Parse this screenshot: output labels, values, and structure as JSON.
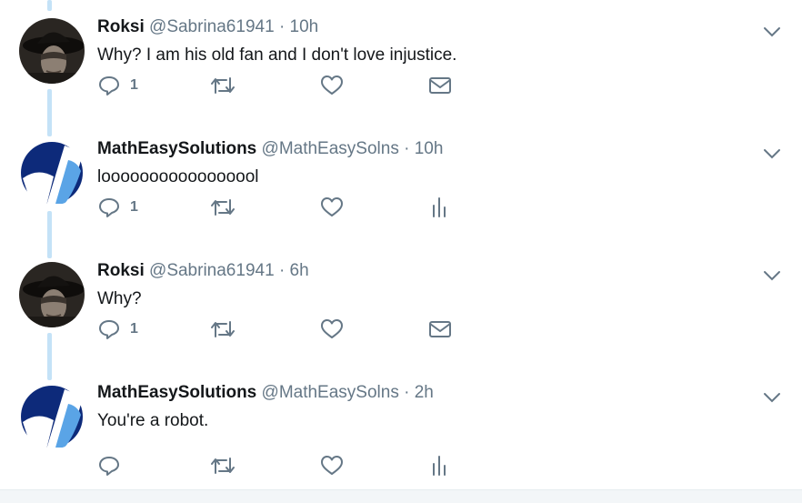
{
  "tweets": [
    {
      "name": "Roksi",
      "handle": "@Sabrina61941",
      "separator": "·",
      "time": "10h",
      "text": "Why? I am his old fan and I don't love injustice.",
      "reply_count": "1",
      "avatar": "hat-woman-photo",
      "last_action_icon": "mail-icon"
    },
    {
      "name": "MathEasySolutions",
      "handle": "@MathEasySolns",
      "separator": "·",
      "time": "10h",
      "text": "looooooooooooooool",
      "reply_count": "1",
      "avatar": "math-logo",
      "last_action_icon": "analytics-icon"
    },
    {
      "name": "Roksi",
      "handle": "@Sabrina61941",
      "separator": "·",
      "time": "6h",
      "text": "Why?",
      "reply_count": "1",
      "avatar": "hat-woman-photo",
      "last_action_icon": "mail-icon"
    },
    {
      "name": "MathEasySolutions",
      "handle": "@MathEasySolns",
      "separator": "·",
      "time": "2h",
      "text": "You're a robot.",
      "reply_count": "",
      "avatar": "math-logo",
      "last_action_icon": "analytics-icon"
    }
  ],
  "colors": {
    "thread_line": "#c4e2f7",
    "icon_gray": "#657786",
    "logo_blue": "#0d2a7a",
    "logo_light_blue": "#5aa4e6"
  }
}
